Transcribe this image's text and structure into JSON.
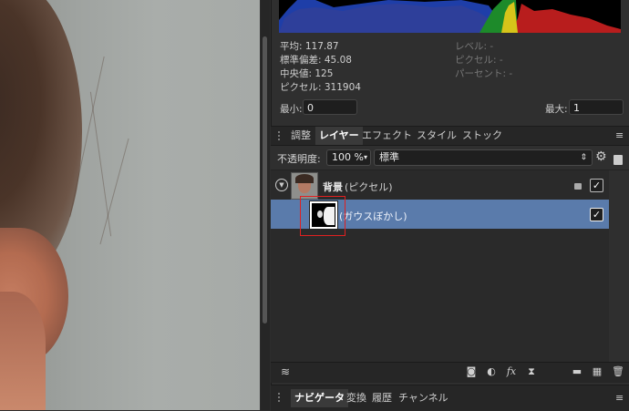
{
  "stats": {
    "mean": "平均: 117.87",
    "stddev": "標準偏差: 45.08",
    "median": "中央値: 125",
    "pixels": "ピクセル: 311904",
    "level": "レベル: -",
    "pixel_count": "ピクセル: -",
    "percent": "パーセント: -"
  },
  "range": {
    "min_label": "最小:",
    "min_value": "0",
    "max_label": "最大:",
    "max_value": "1"
  },
  "tabs": [
    "調整",
    "レイヤー",
    "エフェクト",
    "スタイル",
    "ストック"
  ],
  "opacity": {
    "label": "不透明度:",
    "value": "100 %",
    "blend_mode": "標準"
  },
  "layers": {
    "parent_name": "背景",
    "parent_type": "(ピクセル)",
    "child_name": "(ガウスぼかし)"
  },
  "bottom_tabs": [
    "ナビゲータ",
    "変換",
    "履歴",
    "チャンネル"
  ],
  "colors": {
    "selection": "#5a7bab",
    "highlight_box": "#e02020"
  }
}
